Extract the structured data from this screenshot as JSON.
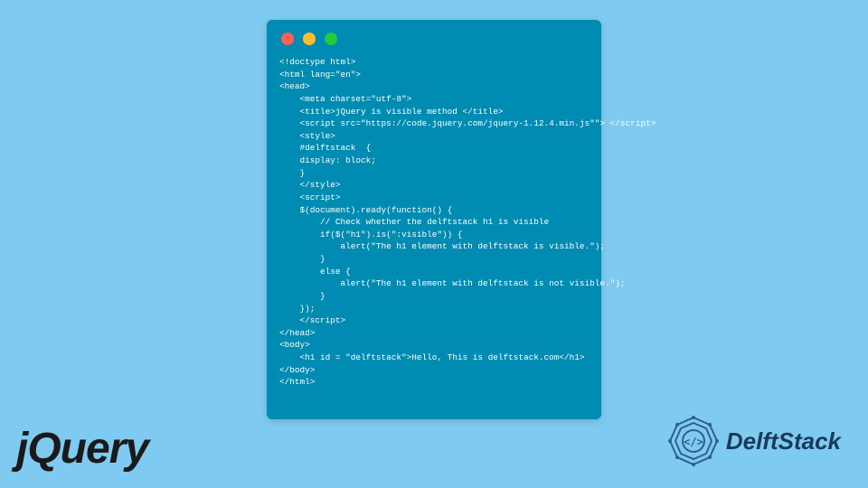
{
  "code_window": {
    "lines": "<!doctype html>\n<html lang=\"en\">\n<head>\n    <meta charset=\"utf-8\">\n    <title>jQuery is visible method </title>\n    <script src=\"https://code.jquery.com/jquery-1.12.4.min.js\"\"> </script>\n    <style>\n    #delftstack  {\n    display: block;\n    }\n    </style>\n    <script>\n    $(document).ready(function() {\n        // Check whether the delftstack h1 is visible\n        if($(\"h1\").is(\":visible\")) {\n            alert(\"The h1 element with delftstack is visible.\");\n        }\n        else {\n            alert(\"The h1 element with delftstack is not visible.\");\n        }\n    });\n    </script>\n</head>\n<body>\n    <h1 id = \"delftstack\">Hello, This is delftstack.com</h1>\n</body>\n</html>"
  },
  "traffic_lights": {
    "red": "#ff5f56",
    "yellow": "#ffbd2e",
    "green": "#27c93f"
  },
  "jquery_logo": {
    "text": "jQuery"
  },
  "delftstack_logo": {
    "text": "DelftStack"
  },
  "colors": {
    "page_bg": "#7fcaf0",
    "window_bg": "#008bb3",
    "code_text": "#ffffff",
    "jquery_color": "#1a1a1a",
    "delftstack_color": "#1a3a5a",
    "delftstack_icon_stroke": "#2d5f8f"
  }
}
